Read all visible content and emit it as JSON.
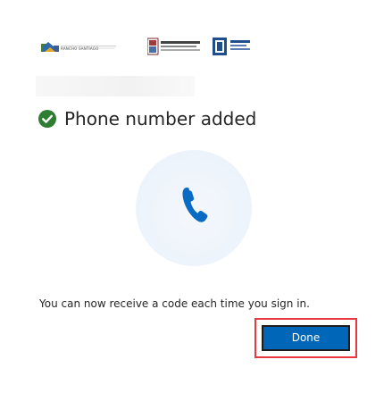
{
  "header": {
    "logos": [
      {
        "name": "Rancho Santiago Community College District",
        "text": "RANCHO SANTIAGO"
      },
      {
        "name": "Santa Ana College",
        "text": "SANTA ANA COLLEGE"
      },
      {
        "name": "Santiago Canyon College",
        "text": "Santiago Canyon College"
      }
    ]
  },
  "dialog": {
    "title": "Phone number added",
    "message": "You can now receive a code each time you sign in.",
    "done_label": "Done"
  },
  "icons": {
    "status": "check-circle-icon",
    "phone": "phone-icon"
  },
  "colors": {
    "success_green": "#2e7d32",
    "phone_blue": "#0a6bc4",
    "button_blue": "#0067b8",
    "highlight_red": "#e8383d",
    "circle_bg": "#eef4fb"
  }
}
